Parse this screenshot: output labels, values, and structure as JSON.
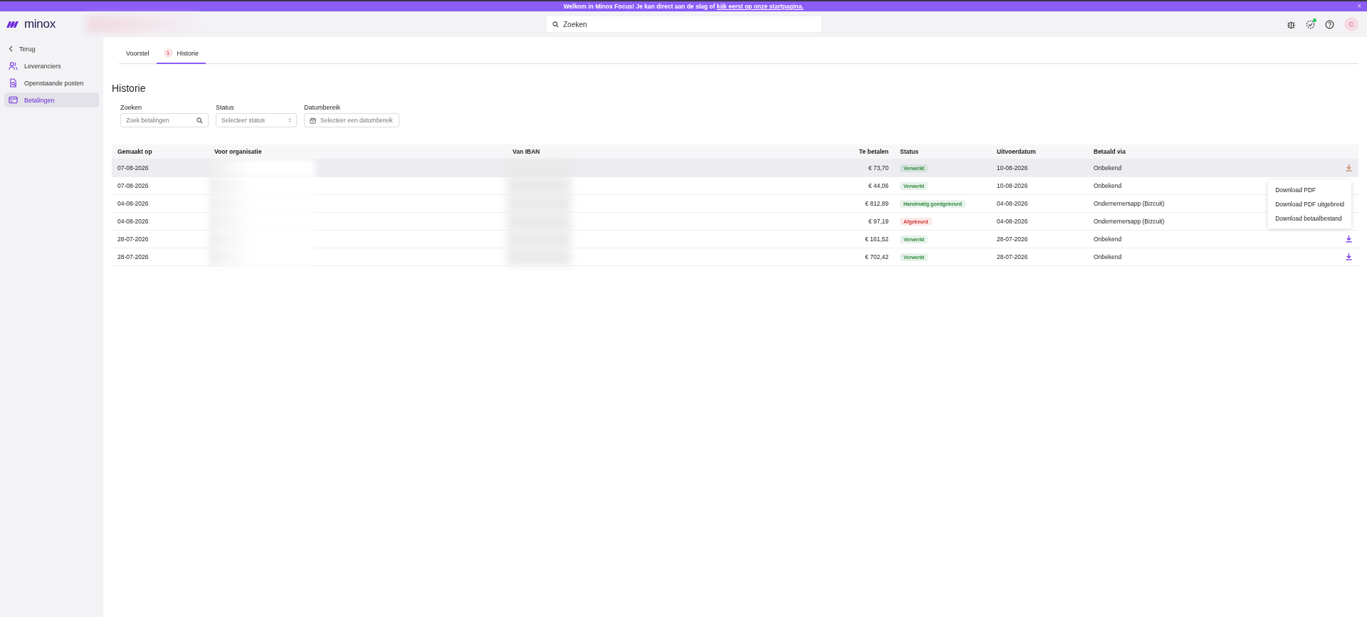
{
  "banner": {
    "text": "Welkom in Minox Focus! Je kan direct aan de slag of ",
    "link": "kijk eerst op onze startpagina.",
    "close": "×"
  },
  "header": {
    "logo": "minox",
    "search": {
      "placeholder": "Zoeken"
    },
    "avatar": "C",
    "notification_dot": true
  },
  "sidebar": {
    "back": "Terug",
    "items": [
      {
        "label": "Leveranciers",
        "selected": false
      },
      {
        "label": "Openstaande posten",
        "selected": false
      },
      {
        "label": "Betalingen",
        "selected": true
      }
    ]
  },
  "tabs": [
    {
      "label": "Voorstel",
      "selected": false
    },
    {
      "label": "Historie",
      "badge": "1",
      "selected": true
    }
  ],
  "heading": "Historie",
  "filters": [
    {
      "label": "Zoeken",
      "placeholder": "Zoek betalingen",
      "kind": "search"
    },
    {
      "label": "Status",
      "placeholder": "Selecteer status",
      "kind": "select"
    },
    {
      "label": "Datumbereik",
      "placeholder": "Selecteer een datumbereik",
      "kind": "date"
    }
  ],
  "table": {
    "columns": [
      "Gemaakt op",
      "Voor organisatie",
      "Van IBAN",
      "Te betalen",
      "Status",
      "Uitvoerdatum",
      "Betaald via"
    ],
    "rows": [
      {
        "created": "07-08-2026",
        "amount": "€ 73,70",
        "status": "Verwerkt",
        "color": "#2e8b3e",
        "date": "10-08-2026",
        "via": "Onbekend",
        "hovered": true,
        "download_icon": true
      },
      {
        "created": "07-08-2026",
        "amount": "€ 44,06",
        "status": "Verwerkt",
        "color": "#2e8b3e",
        "date": "10-08-2026",
        "via": "Onbekend",
        "hovered": false,
        "download_icon": false
      },
      {
        "created": "04-08-2026",
        "amount": "€ 812,89",
        "status": "Handmatig goedgekeurd",
        "color": "#2e8b3e",
        "date": "04-08-2026",
        "via": "Ondernemersapp (Bizcuit)",
        "hovered": false,
        "download_icon": false
      },
      {
        "created": "04-08-2026",
        "amount": "€ 97,19",
        "status": "Afgekeurd",
        "color": "#d13636",
        "date": "04-08-2026",
        "via": "Ondernemersapp (Bizcuit)",
        "hovered": false,
        "download_icon": false
      },
      {
        "created": "28-07-2026",
        "amount": "€ 161,52",
        "status": "Verwerkt",
        "color": "#2e8b3e",
        "date": "28-07-2026",
        "via": "Onbekend",
        "hovered": false,
        "download_icon": true
      },
      {
        "created": "28-07-2026",
        "amount": "€ 702,42",
        "status": "Verwerkt",
        "color": "#2e8b3e",
        "date": "28-07-2026",
        "via": "Onbekend",
        "hovered": false,
        "download_icon": true
      }
    ]
  },
  "download_menu": {
    "open": true,
    "items": [
      "Download PDF",
      "Download PDF uitgebreid",
      "Download betaalbestand"
    ]
  }
}
